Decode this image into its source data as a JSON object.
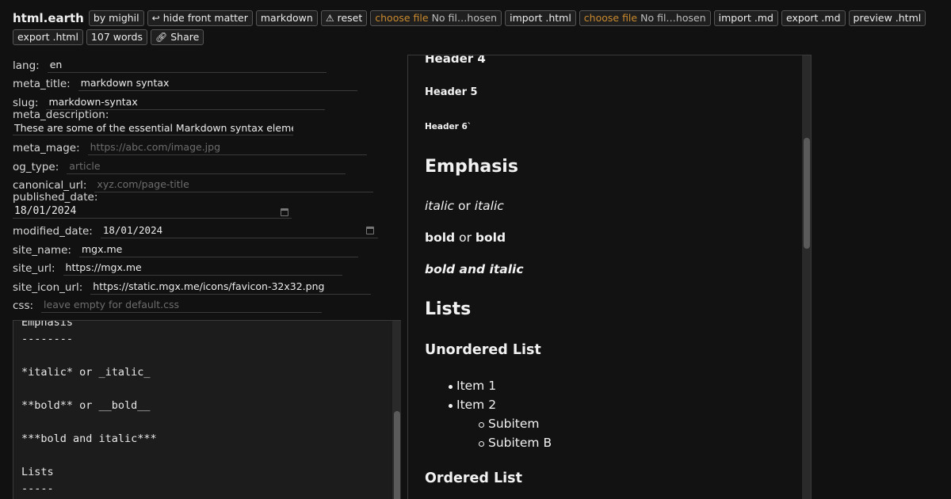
{
  "toolbar": {
    "brand": "html.earth",
    "by_label": "by mighil",
    "hide_fm_label": "hide front matter",
    "markdown_label": "markdown",
    "reset_label": "reset",
    "choose_file_label": "choose file",
    "no_file_label": "No fil…hosen",
    "import_html_label": "import .html",
    "import_md_label": "import .md",
    "export_md_label": "export .md",
    "preview_html_label": "preview .html",
    "export_html_label": "export .html",
    "word_count": "107 words",
    "share_label": "Share"
  },
  "front_matter": {
    "lang": {
      "label": "lang:",
      "value": "en"
    },
    "meta_title": {
      "label": "meta_title:",
      "value": "markdown syntax"
    },
    "slug": {
      "label": "slug:",
      "value": "markdown-syntax"
    },
    "meta_description": {
      "label": "meta_description:",
      "value": "These are some of the essential Markdown syntax elements"
    },
    "meta_mage": {
      "label": "meta_mage:",
      "placeholder": "https://abc.com/image.jpg"
    },
    "og_type": {
      "label": "og_type:",
      "placeholder": "article"
    },
    "canonical_url": {
      "label": "canonical_url:",
      "placeholder": "xyz.com/page-title"
    },
    "published_date": {
      "label": "published_date:",
      "value": "18/01/2024"
    },
    "modified_date": {
      "label": "modified_date:",
      "value": "18/01/2024"
    },
    "site_name": {
      "label": "site_name:",
      "value": "mgx.me"
    },
    "site_url": {
      "label": "site_url:",
      "value": "https://mgx.me"
    },
    "site_icon_url": {
      "label": "site_icon_url:",
      "value": "https://static.mgx.me/icons/favicon-32x32.png"
    },
    "css": {
      "label": "css:",
      "placeholder": "leave empty for default.css"
    }
  },
  "editor": {
    "lines": [
      "Emphasis",
      "--------",
      "",
      "*italic* or _italic_",
      "",
      "**bold** or __bold__",
      "",
      "***bold and italic***",
      "",
      "Lists",
      "-----"
    ]
  },
  "preview": {
    "h4": "Header 4",
    "h5": "Header 5",
    "h6": "Header 6`",
    "emphasis_heading": "Emphasis",
    "italic_a": "italic",
    "or_1": "or",
    "italic_b": "italic",
    "bold_a": "bold",
    "or_2": "or",
    "bold_b": "bold",
    "bold_italic": "bold and italic",
    "lists_heading": "Lists",
    "unordered_heading": "Unordered List",
    "ul_items": [
      "Item 1",
      "Item 2"
    ],
    "sub_items": [
      "Subitem",
      "Subitem B"
    ],
    "ordered_heading": "Ordered List"
  },
  "colors": {
    "background": "#111111",
    "file_button_accent": "#c98a2e",
    "border": "#3a3a3a"
  }
}
